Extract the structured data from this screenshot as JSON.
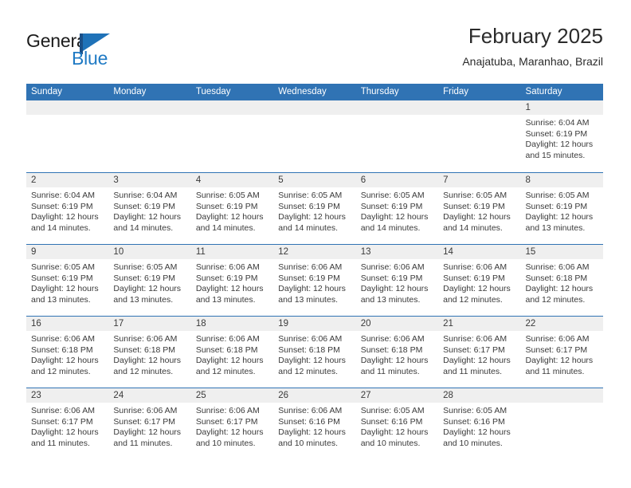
{
  "brand": {
    "name_part1": "General",
    "name_part2": "Blue",
    "flag_icon": "blue-flag-icon"
  },
  "header": {
    "title": "February 2025",
    "subtitle": "Anajatuba, Maranhao, Brazil"
  },
  "colors": {
    "header_blue": "#3073B4",
    "band_gray": "#EFEFEF",
    "brand_blue": "#1F7AC4",
    "text": "#3A3A3A"
  },
  "calendar": {
    "day_headers": [
      "Sunday",
      "Monday",
      "Tuesday",
      "Wednesday",
      "Thursday",
      "Friday",
      "Saturday"
    ],
    "weeks": [
      [
        {
          "empty": true
        },
        {
          "empty": true
        },
        {
          "empty": true
        },
        {
          "empty": true
        },
        {
          "empty": true
        },
        {
          "empty": true
        },
        {
          "day": "1",
          "sunrise": "Sunrise: 6:04 AM",
          "sunset": "Sunset: 6:19 PM",
          "daylight1": "Daylight: 12 hours",
          "daylight2": "and 15 minutes."
        }
      ],
      [
        {
          "day": "2",
          "sunrise": "Sunrise: 6:04 AM",
          "sunset": "Sunset: 6:19 PM",
          "daylight1": "Daylight: 12 hours",
          "daylight2": "and 14 minutes."
        },
        {
          "day": "3",
          "sunrise": "Sunrise: 6:04 AM",
          "sunset": "Sunset: 6:19 PM",
          "daylight1": "Daylight: 12 hours",
          "daylight2": "and 14 minutes."
        },
        {
          "day": "4",
          "sunrise": "Sunrise: 6:05 AM",
          "sunset": "Sunset: 6:19 PM",
          "daylight1": "Daylight: 12 hours",
          "daylight2": "and 14 minutes."
        },
        {
          "day": "5",
          "sunrise": "Sunrise: 6:05 AM",
          "sunset": "Sunset: 6:19 PM",
          "daylight1": "Daylight: 12 hours",
          "daylight2": "and 14 minutes."
        },
        {
          "day": "6",
          "sunrise": "Sunrise: 6:05 AM",
          "sunset": "Sunset: 6:19 PM",
          "daylight1": "Daylight: 12 hours",
          "daylight2": "and 14 minutes."
        },
        {
          "day": "7",
          "sunrise": "Sunrise: 6:05 AM",
          "sunset": "Sunset: 6:19 PM",
          "daylight1": "Daylight: 12 hours",
          "daylight2": "and 14 minutes."
        },
        {
          "day": "8",
          "sunrise": "Sunrise: 6:05 AM",
          "sunset": "Sunset: 6:19 PM",
          "daylight1": "Daylight: 12 hours",
          "daylight2": "and 13 minutes."
        }
      ],
      [
        {
          "day": "9",
          "sunrise": "Sunrise: 6:05 AM",
          "sunset": "Sunset: 6:19 PM",
          "daylight1": "Daylight: 12 hours",
          "daylight2": "and 13 minutes."
        },
        {
          "day": "10",
          "sunrise": "Sunrise: 6:05 AM",
          "sunset": "Sunset: 6:19 PM",
          "daylight1": "Daylight: 12 hours",
          "daylight2": "and 13 minutes."
        },
        {
          "day": "11",
          "sunrise": "Sunrise: 6:06 AM",
          "sunset": "Sunset: 6:19 PM",
          "daylight1": "Daylight: 12 hours",
          "daylight2": "and 13 minutes."
        },
        {
          "day": "12",
          "sunrise": "Sunrise: 6:06 AM",
          "sunset": "Sunset: 6:19 PM",
          "daylight1": "Daylight: 12 hours",
          "daylight2": "and 13 minutes."
        },
        {
          "day": "13",
          "sunrise": "Sunrise: 6:06 AM",
          "sunset": "Sunset: 6:19 PM",
          "daylight1": "Daylight: 12 hours",
          "daylight2": "and 13 minutes."
        },
        {
          "day": "14",
          "sunrise": "Sunrise: 6:06 AM",
          "sunset": "Sunset: 6:19 PM",
          "daylight1": "Daylight: 12 hours",
          "daylight2": "and 12 minutes."
        },
        {
          "day": "15",
          "sunrise": "Sunrise: 6:06 AM",
          "sunset": "Sunset: 6:18 PM",
          "daylight1": "Daylight: 12 hours",
          "daylight2": "and 12 minutes."
        }
      ],
      [
        {
          "day": "16",
          "sunrise": "Sunrise: 6:06 AM",
          "sunset": "Sunset: 6:18 PM",
          "daylight1": "Daylight: 12 hours",
          "daylight2": "and 12 minutes."
        },
        {
          "day": "17",
          "sunrise": "Sunrise: 6:06 AM",
          "sunset": "Sunset: 6:18 PM",
          "daylight1": "Daylight: 12 hours",
          "daylight2": "and 12 minutes."
        },
        {
          "day": "18",
          "sunrise": "Sunrise: 6:06 AM",
          "sunset": "Sunset: 6:18 PM",
          "daylight1": "Daylight: 12 hours",
          "daylight2": "and 12 minutes."
        },
        {
          "day": "19",
          "sunrise": "Sunrise: 6:06 AM",
          "sunset": "Sunset: 6:18 PM",
          "daylight1": "Daylight: 12 hours",
          "daylight2": "and 12 minutes."
        },
        {
          "day": "20",
          "sunrise": "Sunrise: 6:06 AM",
          "sunset": "Sunset: 6:18 PM",
          "daylight1": "Daylight: 12 hours",
          "daylight2": "and 11 minutes."
        },
        {
          "day": "21",
          "sunrise": "Sunrise: 6:06 AM",
          "sunset": "Sunset: 6:17 PM",
          "daylight1": "Daylight: 12 hours",
          "daylight2": "and 11 minutes."
        },
        {
          "day": "22",
          "sunrise": "Sunrise: 6:06 AM",
          "sunset": "Sunset: 6:17 PM",
          "daylight1": "Daylight: 12 hours",
          "daylight2": "and 11 minutes."
        }
      ],
      [
        {
          "day": "23",
          "sunrise": "Sunrise: 6:06 AM",
          "sunset": "Sunset: 6:17 PM",
          "daylight1": "Daylight: 12 hours",
          "daylight2": "and 11 minutes."
        },
        {
          "day": "24",
          "sunrise": "Sunrise: 6:06 AM",
          "sunset": "Sunset: 6:17 PM",
          "daylight1": "Daylight: 12 hours",
          "daylight2": "and 11 minutes."
        },
        {
          "day": "25",
          "sunrise": "Sunrise: 6:06 AM",
          "sunset": "Sunset: 6:17 PM",
          "daylight1": "Daylight: 12 hours",
          "daylight2": "and 10 minutes."
        },
        {
          "day": "26",
          "sunrise": "Sunrise: 6:06 AM",
          "sunset": "Sunset: 6:16 PM",
          "daylight1": "Daylight: 12 hours",
          "daylight2": "and 10 minutes."
        },
        {
          "day": "27",
          "sunrise": "Sunrise: 6:05 AM",
          "sunset": "Sunset: 6:16 PM",
          "daylight1": "Daylight: 12 hours",
          "daylight2": "and 10 minutes."
        },
        {
          "day": "28",
          "sunrise": "Sunrise: 6:05 AM",
          "sunset": "Sunset: 6:16 PM",
          "daylight1": "Daylight: 12 hours",
          "daylight2": "and 10 minutes."
        },
        {
          "empty": true
        }
      ]
    ]
  }
}
